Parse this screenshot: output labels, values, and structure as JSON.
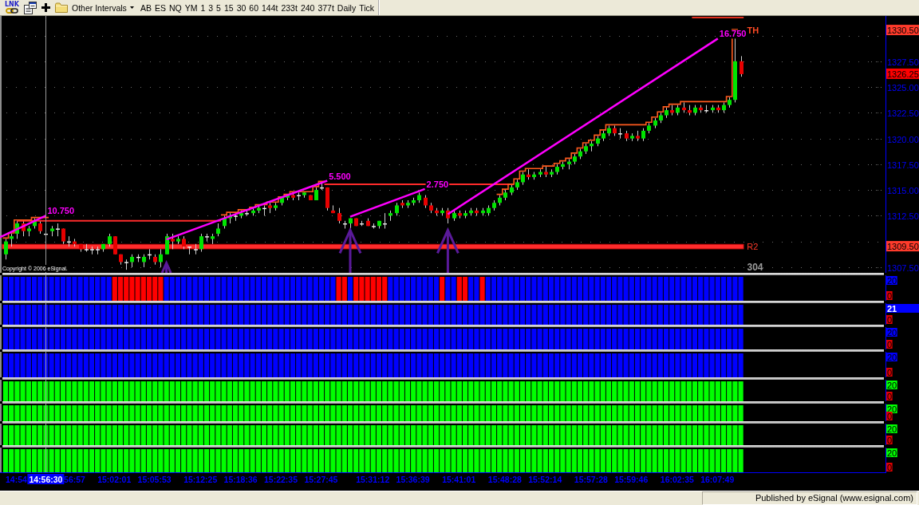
{
  "toolbar": {
    "link_label": "LNK",
    "interval_menu": "Other Intervals",
    "symbols": [
      "AB",
      "ES",
      "NQ",
      "YM"
    ],
    "intervals": [
      "1",
      "3",
      "5",
      "15",
      "30",
      "60",
      "144t",
      "233t",
      "240",
      "377t",
      "Daily",
      "Tick"
    ]
  },
  "price_chart": {
    "axis_labels": [
      "1327.50",
      "1325.00",
      "1322.50",
      "1320.00",
      "1317.50",
      "1315.00",
      "1312.50",
      "1307.50"
    ],
    "trend_labels": [
      "10.750",
      "5.500",
      "2.750",
      "16.750"
    ],
    "badges": [
      {
        "kind": "high",
        "text": "1330.50",
        "color": "#ff3b2b"
      },
      {
        "kind": "last",
        "text": "1326.25",
        "color": "#ff0000"
      },
      {
        "kind": "level",
        "text": "1309.50",
        "color": "#ff3b2b"
      }
    ],
    "high_label": "TH",
    "level_label": "R2",
    "corner_label": "304",
    "copyright": "Copyright © 2006 eSignal."
  },
  "indicator_panels": [
    {
      "color": "#0000ff",
      "top_label": "20",
      "top_label_highlighted": false,
      "bottom_label": "0"
    },
    {
      "color": "#0000ff",
      "top_label": "21",
      "top_label_highlighted": true,
      "bottom_label": "0"
    },
    {
      "color": "#0000ff",
      "top_label": "20",
      "top_label_highlighted": false,
      "bottom_label": "0"
    },
    {
      "color": "#0000ff",
      "top_label": "20",
      "top_label_highlighted": false,
      "bottom_label": "0"
    },
    {
      "color": "#00ff00",
      "top_label": "20",
      "top_label_highlighted": false,
      "bottom_label": "0"
    },
    {
      "color": "#00ff00",
      "top_label": "20",
      "top_label_highlighted": false,
      "bottom_label": "0"
    },
    {
      "color": "#00ff00",
      "top_label": "20",
      "top_label_highlighted": false,
      "bottom_label": "0"
    },
    {
      "color": "#00ff00",
      "top_label": "20",
      "top_label_highlighted": false,
      "bottom_label": "0"
    }
  ],
  "time_axis": {
    "labels": [
      "14:54",
      "56:57",
      "15:02:01",
      "15:05:53",
      "15:12:25",
      "15:18:36",
      "15:22:35",
      "15:27:45",
      "15:31:12",
      "15:36:39",
      "15:41:01",
      "15:48:28",
      "15:52:14",
      "15:57:28",
      "15:59:46",
      "16:02:35",
      "16:07:49"
    ],
    "cursor_label": "14:56:30"
  },
  "status_bar": {
    "text": "Published by eSignal (www.esignal.com)"
  }
}
